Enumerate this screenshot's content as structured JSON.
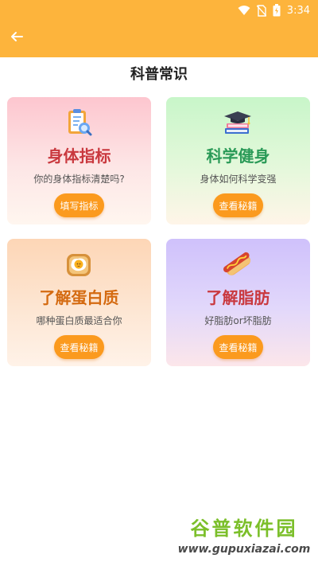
{
  "status_bar": {
    "time": "3:34",
    "icons": [
      "wifi-icon",
      "no-sim-icon",
      "battery-icon"
    ]
  },
  "header": {
    "back_icon": "arrow-left-icon",
    "color": "#fdb43c"
  },
  "page": {
    "title": "科普常识"
  },
  "cards": [
    {
      "icon": "clipboard-checklist-icon",
      "title": "身体指标",
      "title_color": "#c9383e",
      "subtitle": "你的身体指标清楚吗?",
      "button": "填写指标"
    },
    {
      "icon": "books-graduation-cap-icon",
      "title": "科学健身",
      "title_color": "#2a9a57",
      "subtitle": "身体如何科学变强",
      "button": "查看秘籍"
    },
    {
      "icon": "fried-egg-toast-icon",
      "title": "了解蛋白质",
      "title_color": "#d46a10",
      "subtitle": "哪种蛋白质最适合你",
      "button": "查看秘籍"
    },
    {
      "icon": "hot-dog-icon",
      "title": "了解脂肪",
      "title_color": "#c9383e",
      "subtitle": "好脂肪or坏脂肪",
      "button": "查看秘籍"
    }
  ],
  "accent_button_color": "#fb9a1e",
  "watermark": {
    "top": "谷普软件园",
    "bottom": "www.gupuxiazai.com"
  }
}
